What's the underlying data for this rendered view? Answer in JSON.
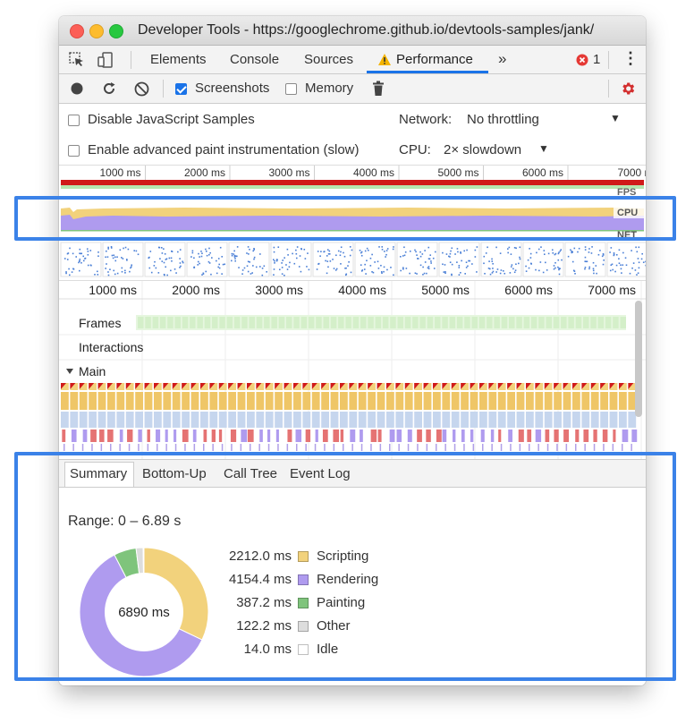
{
  "window": {
    "title": "Developer Tools - https://googlechrome.github.io/devtools-samples/jank/"
  },
  "tabs": {
    "items": [
      "Elements",
      "Console",
      "Sources",
      "Performance"
    ],
    "more": "»",
    "error_count": "1",
    "menu": "⋮"
  },
  "toolbar": {
    "screenshots_label": "Screenshots",
    "screenshots_checked": true,
    "memory_label": "Memory",
    "memory_checked": false
  },
  "settings": {
    "disable_js_label": "Disable JavaScript Samples",
    "paint_label": "Enable advanced paint instrumentation (slow)",
    "network_label": "Network:",
    "network_value": "No throttling",
    "cpu_label": "CPU:",
    "cpu_value": "2× slowdown"
  },
  "overview": {
    "ticks": [
      "1000 ms",
      "2000 ms",
      "3000 ms",
      "4000 ms",
      "5000 ms",
      "6000 ms",
      "7000 r"
    ],
    "fps_label": "FPS",
    "cpu_label": "CPU",
    "net_label": "NET"
  },
  "timeline": {
    "ticks": [
      "1000 ms",
      "2000 ms",
      "3000 ms",
      "4000 ms",
      "5000 ms",
      "6000 ms",
      "7000 ms"
    ],
    "frames_label": "Frames",
    "interactions_label": "Interactions",
    "main_label": "Main"
  },
  "summary": {
    "tabs": [
      "Summary",
      "Bottom-Up",
      "Call Tree",
      "Event Log"
    ],
    "range": "Range: 0 – 6.89 s",
    "total": "6890 ms",
    "items": [
      {
        "value": "2212.0 ms",
        "name": "Scripting",
        "color": "#f2d27c"
      },
      {
        "value": "4154.4 ms",
        "name": "Rendering",
        "color": "#af9bef"
      },
      {
        "value": "387.2 ms",
        "name": "Painting",
        "color": "#7fc47c"
      },
      {
        "value": "122.2 ms",
        "name": "Other",
        "color": "#dddddd"
      },
      {
        "value": "14.0 ms",
        "name": "Idle",
        "color": "#ffffff"
      }
    ]
  },
  "colors": {
    "accent": "#1a73e8",
    "highlight": "#3b82e8",
    "record": "#d32f2f",
    "scripting": "#f2d27c",
    "rendering": "#af9bef",
    "painting": "#7fc47c"
  }
}
